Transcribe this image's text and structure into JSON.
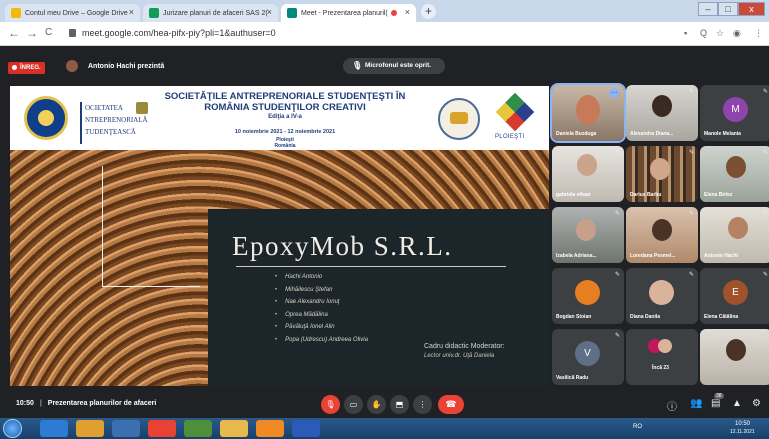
{
  "browser": {
    "tabs": [
      {
        "title": "Contul meu Drive – Google Drive",
        "close": "×",
        "favicon_color": "#f2b90b"
      },
      {
        "title": "Jurizare planuri de afaceri SAS 2(",
        "close": "×",
        "favicon_color": "#0f9d58"
      },
      {
        "title": "Meet - Prezentarea planuril(",
        "close": "×",
        "favicon_color": "#00897b"
      }
    ],
    "new_tab": "+",
    "window_controls": {
      "minimize": "–",
      "maximize": "□",
      "close": "x"
    },
    "nav": {
      "back": "←",
      "forward": "→",
      "reload": "C"
    },
    "url": "meet.google.com/hea-pifx-piy?pli=1&authuser=0",
    "tools": {
      "camera": "▪",
      "zoom": "Q",
      "star": "☆",
      "extension": "◉",
      "menu": "⋮"
    }
  },
  "meet": {
    "rec_label": "ÎNREG.",
    "presenting_label": "Antonio Hachi prezintă",
    "mic_notice": "Microfonul este oprit.",
    "mic_notice_icon": "🎙"
  },
  "slide": {
    "org_lines": [
      "OCIETATEA",
      "NTREPRENORIALĂ",
      "TUDENŢEASCĂ"
    ],
    "title_lines": [
      "SOCIETĂŢILE ANTREPRENORIALE STUDENŢEŞTI ÎN",
      "ROMÂNIA STUDENŢILOR CREATIVI"
    ],
    "edition": "Ediţia a IV-a",
    "dates": "10 noiembrie 2021 - 12 noiembrie 2021",
    "city": "Ploieşti",
    "country": "România",
    "logo_right_text": "PLOIEŞTI",
    "company": "EpoxyMob S.R.L.",
    "members": [
      "Hachi Antonio",
      "Mihăilescu Ştefan",
      "Nae Alexandru Ionuţ",
      "Oprea Mădălina",
      "Păvăluţă Ionel Alin",
      "Popa (Udrescu) Andreea Olivia"
    ],
    "moderator_label": "Cadru didactic Moderator:",
    "moderator_name": "Lector univ.dr. Uţă Daniela"
  },
  "participants": [
    {
      "name": "Daniela Buzduga",
      "type": "video",
      "active": true
    },
    {
      "name": "Alexandra Diana...",
      "type": "video"
    },
    {
      "name": "Manole Melania",
      "type": "initial",
      "initial": "M",
      "color": "#8e44ad"
    },
    {
      "name": "gabriela vilsan",
      "type": "video"
    },
    {
      "name": "Darius Barbu",
      "type": "video"
    },
    {
      "name": "Elena Birlez",
      "type": "video"
    },
    {
      "name": "Izabela Adriana...",
      "type": "video"
    },
    {
      "name": "Loredana Pesmel...",
      "type": "video"
    },
    {
      "name": "Antonio Hachi",
      "type": "video"
    },
    {
      "name": "Bogdan Stoian",
      "type": "avatar",
      "color": "#e67e22"
    },
    {
      "name": "Diana Danila",
      "type": "avatar",
      "color": "#d9b39a"
    },
    {
      "name": "Elena Cătălina",
      "type": "initial",
      "initial": "E",
      "color": "#a0522d"
    },
    {
      "name": "Vasilică Radu",
      "type": "initial",
      "initial": "V",
      "color": "#5f6f86"
    },
    {
      "name": "Încă 23",
      "type": "more"
    },
    {
      "name": "",
      "type": "video"
    }
  ],
  "controls": {
    "time": "10:50",
    "separator": "|",
    "meeting_title": "Prezentarea planurilor de afaceri",
    "mic": "🎙",
    "camera": "▭",
    "raise_hand": "✋",
    "present": "⬒",
    "more": "⋮",
    "hangup": "☎",
    "info": "ⓘ",
    "people": "👥",
    "people_count": "38",
    "chat": "▤",
    "activities": "▲",
    "security": "⚙"
  },
  "taskbar": {
    "tray_text": "RO",
    "tray_time": "10:50",
    "tray_date": "12.11.2021",
    "apps": [
      {
        "name": "ie",
        "color": "#2f7bd3"
      },
      {
        "name": "explorer",
        "color": "#e0a030"
      },
      {
        "name": "media",
        "color": "#3a6fb0"
      },
      {
        "name": "chrome",
        "color": "#e94235"
      },
      {
        "name": "flag",
        "color": "#4f8f3a"
      },
      {
        "name": "folder",
        "color": "#e6b94a"
      },
      {
        "name": "firefox",
        "color": "#f08a24"
      },
      {
        "name": "word",
        "color": "#2a5bb8"
      }
    ]
  }
}
